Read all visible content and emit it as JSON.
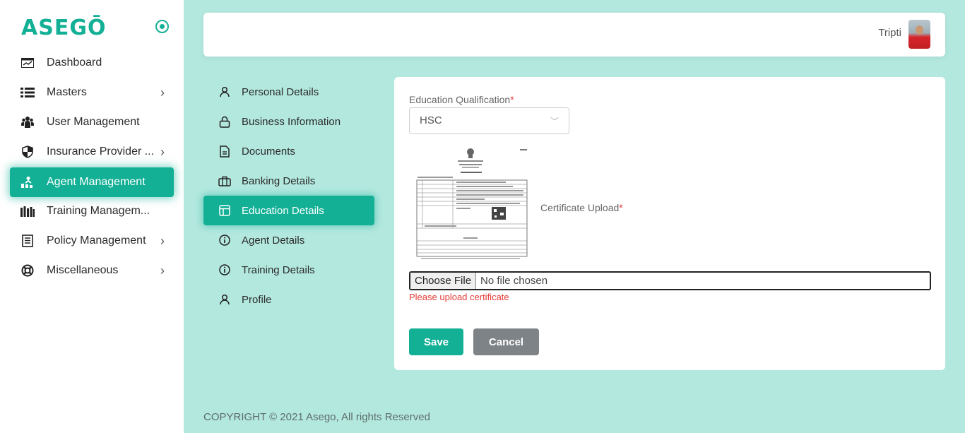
{
  "brand": {
    "logo_text": "ASEGŌ",
    "accent": "#13b096"
  },
  "sidebar": {
    "items": [
      {
        "label": "Dashboard",
        "icon": "dashboard-icon",
        "has_chevron": false
      },
      {
        "label": "Masters",
        "icon": "list-icon",
        "has_chevron": true
      },
      {
        "label": "User Management",
        "icon": "users-icon",
        "has_chevron": false
      },
      {
        "label": "Insurance Provider ...",
        "icon": "shield-icon",
        "has_chevron": true
      },
      {
        "label": "Agent Management",
        "icon": "agent-icon",
        "has_chevron": false,
        "active": true
      },
      {
        "label": "Training Managem...",
        "icon": "books-icon",
        "has_chevron": false
      },
      {
        "label": "Policy Management",
        "icon": "policy-icon",
        "has_chevron": true
      },
      {
        "label": "Miscellaneous",
        "icon": "lifebuoy-icon",
        "has_chevron": true
      }
    ]
  },
  "header": {
    "user_name": "Tripti"
  },
  "submenu": {
    "items": [
      {
        "label": "Personal Details",
        "icon": "user-icon"
      },
      {
        "label": "Business Information",
        "icon": "lock-icon"
      },
      {
        "label": "Documents",
        "icon": "document-icon"
      },
      {
        "label": "Banking Details",
        "icon": "briefcase-icon"
      },
      {
        "label": "Education Details",
        "icon": "layout-icon",
        "active": true
      },
      {
        "label": "Agent Details",
        "icon": "info-icon"
      },
      {
        "label": "Training Details",
        "icon": "info-icon"
      },
      {
        "label": "Profile",
        "icon": "user-icon"
      }
    ]
  },
  "form": {
    "qualification_label": "Education Qualification",
    "qualification_value": "HSC",
    "certificate_label": "Certificate Upload",
    "required_mark": "*",
    "file_button": "Choose File",
    "file_status": "No file chosen",
    "error": "Please upload certificate",
    "save_label": "Save",
    "cancel_label": "Cancel"
  },
  "footer": {
    "copyright": "COPYRIGHT © 2021 Asego, All rights Reserved"
  }
}
